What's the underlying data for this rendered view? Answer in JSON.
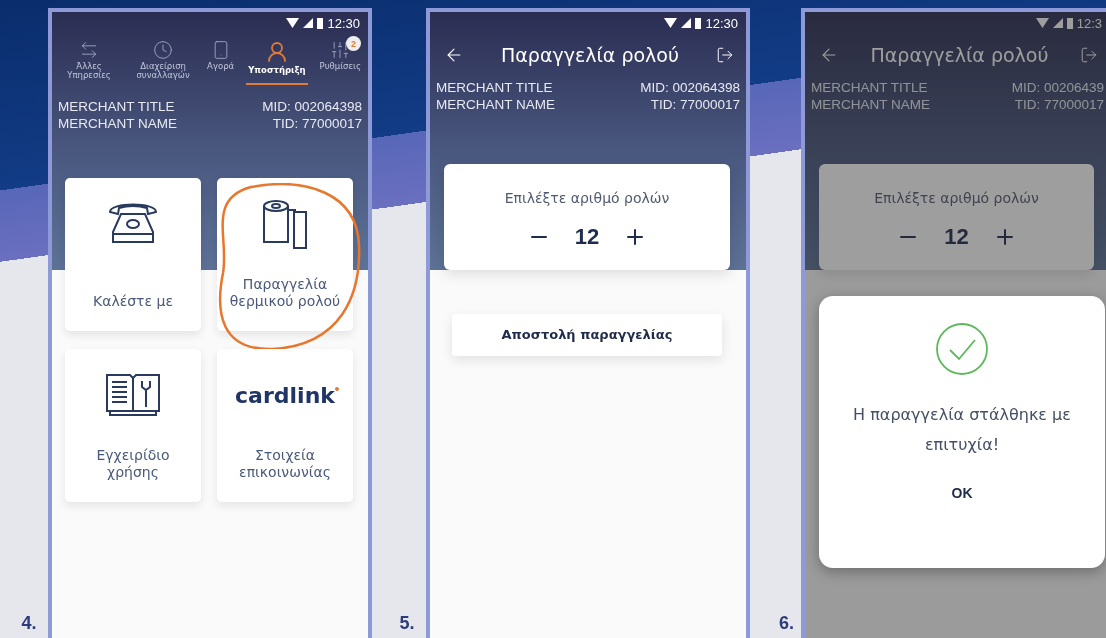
{
  "screens": [
    {
      "step": "4.",
      "kind": "home",
      "time": "12:30",
      "tabs": [
        {
          "label": "Άλλες Υπηρεσίες",
          "selected": false
        },
        {
          "label": "Διαχείριση συναλλαγών",
          "selected": false
        },
        {
          "label": "Αγορά",
          "selected": false
        },
        {
          "label": "Υποστήριξη",
          "selected": true
        },
        {
          "label": "Ρυθμίσεις",
          "selected": false,
          "badge": "2"
        }
      ],
      "merchant": {
        "title": "MERCHANT TITLE",
        "name": "MERCHANT NAME",
        "mid": "MID: 002064398",
        "tid": "TID: 77000017"
      },
      "tiles": [
        {
          "kind": "phone",
          "label": "Καλέστε με",
          "highlighted": false
        },
        {
          "kind": "roll",
          "label": "Παραγγελία θερμικού ρολού",
          "highlighted": true
        },
        {
          "kind": "manual",
          "label": "Εγχειρίδιο χρήσης",
          "highlighted": false
        },
        {
          "kind": "logo",
          "logo": "cardlink",
          "label": "Στοιχεία επικοινωνίας",
          "highlighted": false
        }
      ]
    },
    {
      "step": "5.",
      "kind": "order",
      "time": "12:30",
      "title": "Παραγγελία ρολού",
      "merchant": {
        "title": "MERCHANT TITLE",
        "name": "MERCHANT NAME",
        "mid": "MID: 002064398",
        "tid": "TID: 77000017"
      },
      "prompt": "Επιλέξτε αριθμό ρολών",
      "quantity": "12",
      "button": "Αποστολή παραγγελίας"
    },
    {
      "step": "6.",
      "kind": "order",
      "time": "12:3",
      "dimmed": true,
      "title": "Παραγγελία ρολού",
      "merchant": {
        "title": "MERCHANT TITLE",
        "name": "MERCHANT NAME",
        "mid": "MID: 00206439",
        "tid": "TID: 77000017"
      },
      "prompt": "Επιλέξτε αριθμό ρολών",
      "quantity": "12",
      "dialog": {
        "message": "Η παραγγελία στάλθηκε με επιτυχία!",
        "ok": "OK"
      }
    }
  ]
}
